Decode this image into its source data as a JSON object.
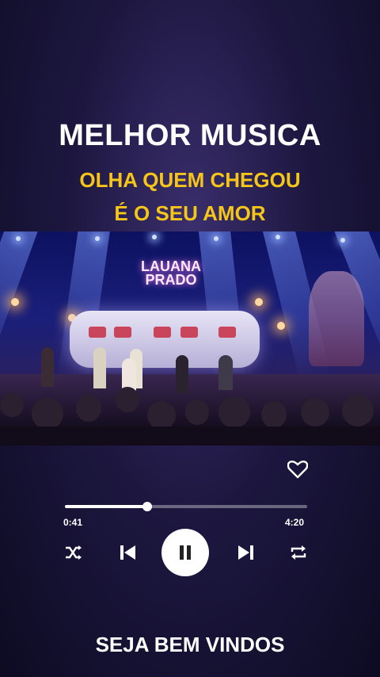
{
  "header": {
    "title": "MELHOR MUSICA",
    "subtitle_line1": "OLHA QUEM CHEGOU",
    "subtitle_line2": "É O SEU AMOR"
  },
  "video": {
    "logo_line1": "LAUANA",
    "logo_line2": "PRADO"
  },
  "player": {
    "elapsed": "0:41",
    "duration": "4:20",
    "progress_fraction": 0.34,
    "icons": {
      "like": "heart-icon",
      "shuffle": "shuffle-icon",
      "previous": "skip-previous-icon",
      "play_pause": "pause-icon",
      "next": "skip-next-icon",
      "repeat": "repeat-icon"
    }
  },
  "footer": {
    "text": "SEJA BEM VINDOS"
  },
  "colors": {
    "accent_yellow": "#f5c518",
    "text_white": "#ffffff"
  }
}
